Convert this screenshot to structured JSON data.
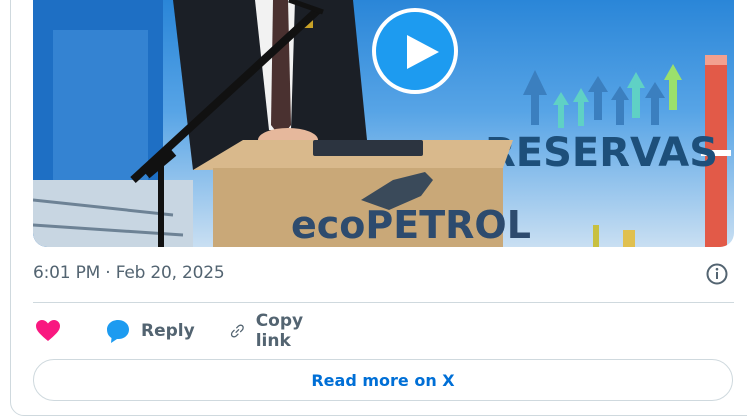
{
  "tweet": {
    "timestamp": "6:01 PM · Feb 20, 2025",
    "media": {
      "banner_text": "RESERVAS",
      "podium_logo": "ecoPETROL",
      "play_icon": "play-icon"
    },
    "actions": {
      "like_icon": "heart-icon",
      "reply_icon": "reply-bubble-icon",
      "reply_label": "Reply",
      "copy_icon": "link-icon",
      "copy_label": "Copy link"
    },
    "read_more_label": "Read more on X",
    "info_icon": "info-icon"
  },
  "colors": {
    "accent": "#1d9bf0",
    "like": "#f91880",
    "muted_text": "#536471",
    "link": "#006fd6",
    "border": "#cfd9de"
  }
}
